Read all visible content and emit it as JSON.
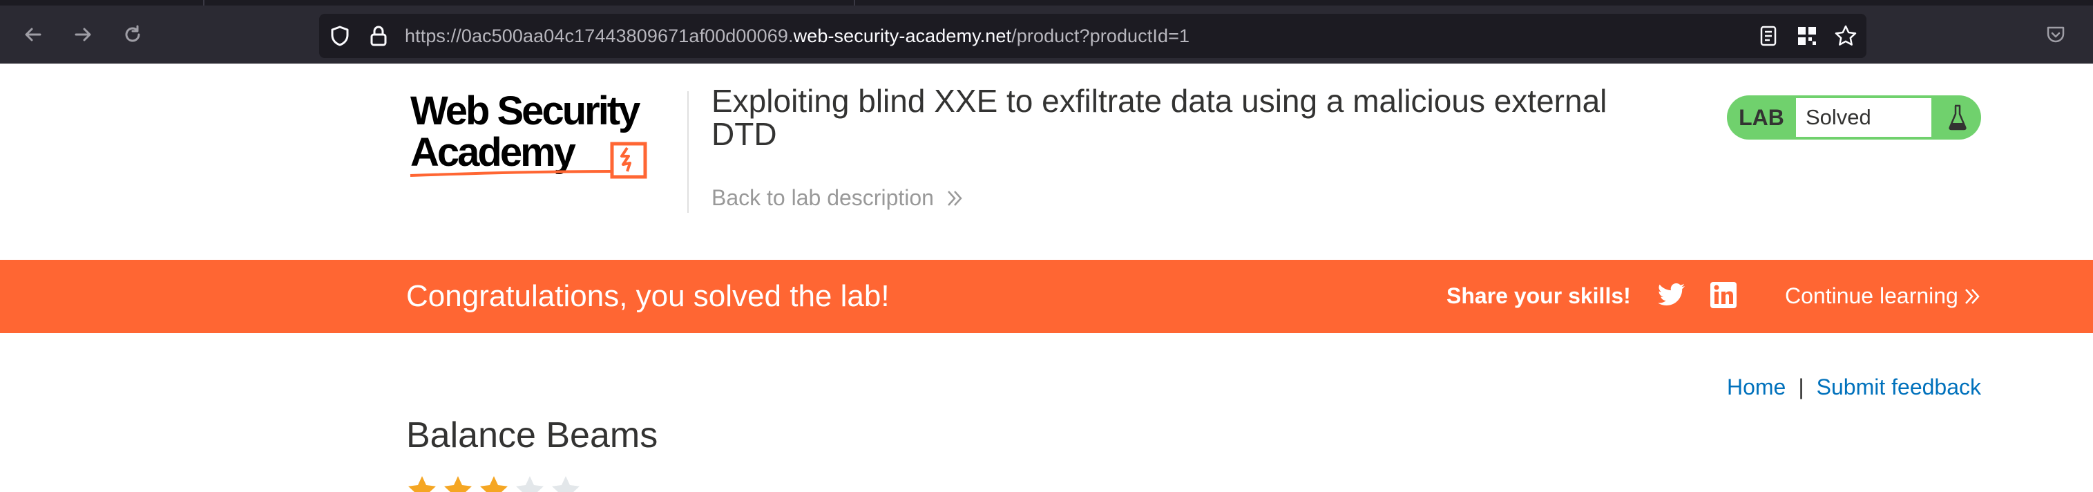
{
  "browser": {
    "url_prefix": "https://0ac500aa04c17443809671af00d00069.",
    "url_host": "web-security-academy.net",
    "url_path": "/product?productId=1",
    "icons": [
      "back-icon",
      "forward-icon",
      "reload-icon",
      "shield-icon",
      "lock-icon",
      "reader-icon",
      "qr-icon",
      "star-icon",
      "pocket-icon"
    ]
  },
  "header": {
    "logo_line1": "Web Security",
    "logo_line2": "Academy",
    "lab_title": "Exploiting blind XXE to exfiltrate data using a malicious external DTD",
    "back_link": "Back to lab description",
    "lab_label": "LAB",
    "lab_status": "Solved",
    "status_color": "#70d16d"
  },
  "banner": {
    "message": "Congratulations, you solved the lab!",
    "share_label": "Share your skills!",
    "continue_label": "Continue learning",
    "color": "#ff6633"
  },
  "nav": {
    "home": "Home",
    "separator": "|",
    "feedback": "Submit feedback"
  },
  "product": {
    "name": "Balance Beams",
    "rating": 3,
    "rating_max": 5
  }
}
